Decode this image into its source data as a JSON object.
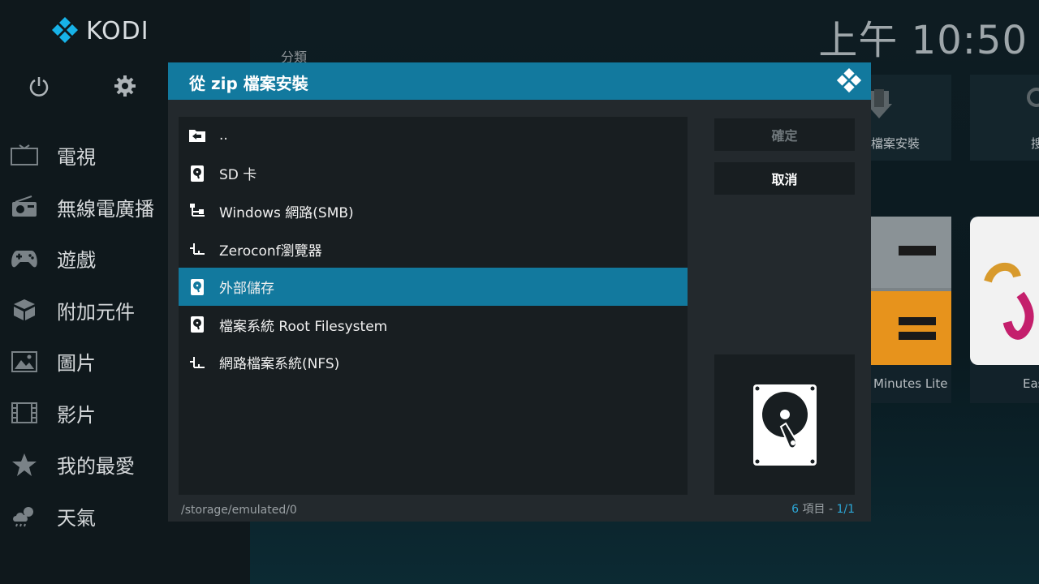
{
  "app": {
    "logo_text": "KODI"
  },
  "clock": "上午 10:50",
  "category_label": "分類",
  "sidebar": {
    "items": [
      {
        "label": "電視",
        "icon": "tv-icon"
      },
      {
        "label": "無線電廣播",
        "icon": "radio-icon"
      },
      {
        "label": "遊戲",
        "icon": "gamepad-icon"
      },
      {
        "label": "附加元件",
        "icon": "addons-box-icon"
      },
      {
        "label": "圖片",
        "icon": "pictures-icon"
      },
      {
        "label": "影片",
        "icon": "film-icon"
      },
      {
        "label": "我的最愛",
        "icon": "star-icon"
      },
      {
        "label": "天氣",
        "icon": "weather-icon"
      }
    ]
  },
  "background_tiles": {
    "install_label": "檔案安裝",
    "search_label": "搜",
    "tile1_label": "Minutes Lite",
    "tile2_label": "Easy"
  },
  "dialog": {
    "title": "從 zip 檔案安裝",
    "files": [
      {
        "name": "..",
        "icon": "folder-back-icon"
      },
      {
        "name": "SD 卡",
        "icon": "harddisk-icon"
      },
      {
        "name": "Windows 網路(SMB)",
        "icon": "network-icon"
      },
      {
        "name": "Zeroconf瀏覽器",
        "icon": "network-icon"
      },
      {
        "name": "外部儲存",
        "icon": "harddisk-icon",
        "selected": true
      },
      {
        "name": "檔案系統 Root Filesystem",
        "icon": "harddisk-icon"
      },
      {
        "name": "網路檔案系統(NFS)",
        "icon": "network-icon"
      }
    ],
    "ok_label": "確定",
    "cancel_label": "取消",
    "path": "/storage/emulated/0",
    "count_num": "6",
    "count_word": "項目 -",
    "page": "1/1"
  },
  "colors": {
    "accent": "#12799e",
    "highlight_text": "#2ca8d8"
  }
}
